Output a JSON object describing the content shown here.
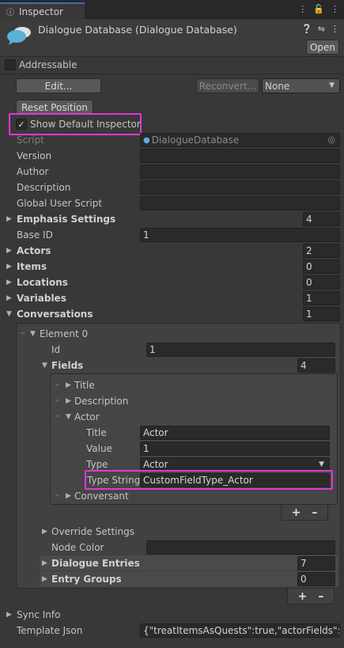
{
  "tab": {
    "title": "Inspector"
  },
  "header": {
    "title": "Dialogue Database (Dialogue Database)",
    "open_label": "Open",
    "addressable_label": "Addressable"
  },
  "toolbar": {
    "edit_label": "Edit...",
    "reconvert_label": "Reconvert...",
    "none_value": "None",
    "reset_position_label": "Reset Position",
    "show_default_inspector_label": "Show Default Inspector"
  },
  "props": {
    "script_label": "Script",
    "script_value": "DialogueDatabase",
    "version_label": "Version",
    "author_label": "Author",
    "description_label": "Description",
    "global_user_script_label": "Global User Script",
    "emphasis_settings_label": "Emphasis Settings",
    "emphasis_settings_count": "4",
    "base_id_label": "Base ID",
    "base_id_value": "1",
    "actors_label": "Actors",
    "actors_count": "2",
    "items_label": "Items",
    "items_count": "0",
    "locations_label": "Locations",
    "locations_count": "0",
    "variables_label": "Variables",
    "variables_count": "1",
    "conversations_label": "Conversations",
    "conversations_count": "1"
  },
  "element0": {
    "label": "Element 0",
    "id_label": "Id",
    "id_value": "1",
    "fields_label": "Fields",
    "fields_count": "4",
    "title_label": "Title",
    "description_label": "Description",
    "actor_label": "Actor",
    "actor_title_label": "Title",
    "actor_title_value": "Actor",
    "actor_value_label": "Value",
    "actor_value_value": "1",
    "actor_type_label": "Type",
    "actor_type_value": "Actor",
    "actor_type_string_label": "Type String",
    "actor_type_string_value": "CustomFieldType_Actor",
    "conversant_label": "Conversant",
    "override_settings_label": "Override Settings",
    "node_color_label": "Node Color",
    "dialogue_entries_label": "Dialogue Entries",
    "dialogue_entries_count": "7",
    "entry_groups_label": "Entry Groups",
    "entry_groups_count": "0"
  },
  "footer": {
    "sync_info_label": "Sync Info",
    "template_json_label": "Template Json",
    "template_json_value": "{\"treatItemsAsQuests\":true,\"actorFields\":[{\"ti"
  },
  "colors": {
    "highlight": "#e236d6",
    "tab_accent": "#3a72b0"
  }
}
